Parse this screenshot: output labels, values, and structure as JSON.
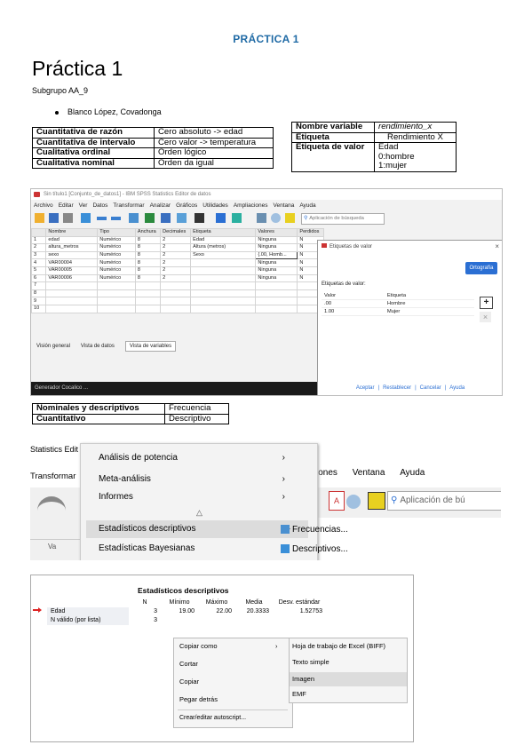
{
  "header": "PRÁCTICA 1",
  "title": "Práctica 1",
  "subtitle": "Subgrupo AA_9",
  "members": [
    "Blanco López, Covadonga"
  ],
  "var_types_table": [
    [
      "Cuantitativa de razón",
      "Cero absoluto -> edad"
    ],
    [
      "Cuantitativa de intervalo",
      "Cero valor -> temperatura"
    ],
    [
      "Cualitativa ordinal",
      "Orden lógico"
    ],
    [
      "Cualitativa nominal",
      "Orden da igual"
    ]
  ],
  "var_props_table": {
    "nombre_label": "Nombre variable",
    "nombre_value": "rendimiento_x",
    "etiqueta_label": "Etiqueta",
    "etiqueta_value": "Rendimiento X",
    "valor_label": "Etiqueta de valor",
    "valor_lines": [
      "Edad",
      "0:hombre",
      "1:mujer"
    ]
  },
  "spss": {
    "window_title": "Sin título1 [Conjunto_de_datos1] - IBM SPSS Statistics Editor de datos",
    "menu": [
      "Archivo",
      "Editar",
      "Ver",
      "Datos",
      "Transformar",
      "Analizar",
      "Gráficos",
      "Utilidades",
      "Ampliaciones",
      "Ventana",
      "Ayuda"
    ],
    "search_placeholder": "Aplicación de búsqueda",
    "columns": [
      "",
      "Nombre",
      "Tipo",
      "Anchura",
      "Decimales",
      "Etiqueta",
      "Valores",
      "Perdidos",
      "Columnas",
      "Alineación",
      "Medida",
      "Rol"
    ],
    "rows": [
      [
        "1",
        "edad",
        "Numérico",
        "8",
        "2",
        "Edad",
        "Ninguna",
        "N"
      ],
      [
        "2",
        "altura_metros",
        "Numérico",
        "8",
        "2",
        "Altura (metros)",
        "Ninguna",
        "N"
      ],
      [
        "3",
        "sexo",
        "Numérico",
        "8",
        "2",
        "Sexo",
        "{.00, Homb...",
        "N"
      ],
      [
        "4",
        "VAR00004",
        "Numérico",
        "8",
        "2",
        "",
        "Ninguna",
        "N"
      ],
      [
        "5",
        "VAR00005",
        "Numérico",
        "8",
        "2",
        "",
        "Ninguna",
        "N"
      ],
      [
        "6",
        "VAR00006",
        "Numérico",
        "8",
        "2",
        "",
        "Ninguna",
        "N"
      ],
      [
        "7",
        "",
        "",
        "",
        "",
        "",
        "",
        ""
      ],
      [
        "8",
        "",
        "",
        "",
        "",
        "",
        "",
        ""
      ],
      [
        "9",
        "",
        "",
        "",
        "",
        "",
        "",
        ""
      ],
      [
        "10",
        "",
        "",
        "",
        "",
        "",
        "",
        ""
      ]
    ],
    "tabs": [
      "Visión general",
      "Vista de datos",
      "Vista de variables"
    ],
    "status": "Generador Cocalico ...",
    "dialog": {
      "title": "Etiquetas de valor",
      "ortografia": "Ortografía",
      "section": "Etiquetas de valor:",
      "col_valor": "Valor",
      "col_etiqueta": "Etiqueta",
      "items": [
        [
          ".00",
          "Hombre"
        ],
        [
          "1.00",
          "Mujer"
        ]
      ],
      "buttons": [
        "Aceptar",
        "Restablecer",
        "Cancelar",
        "Ayuda"
      ]
    }
  },
  "table2": [
    [
      "Nominales y descriptivos",
      "Frecuencia"
    ],
    [
      "Cuantitativo",
      "Descriptivo"
    ]
  ],
  "menu_shot": {
    "top_left_1": "Statistics Edit",
    "top_left_2": "Transformar",
    "top_right": [
      "iones",
      "Ventana",
      "Ayuda"
    ],
    "search_placeholder": "Aplicación de bú",
    "items": [
      "Análisis de potencia",
      "Meta-análisis",
      "Informes",
      "Estadísticos descriptivos",
      "Estadísticas Bayesianas"
    ],
    "sub_items": [
      "Frecuencias...",
      "Descriptivos..."
    ],
    "left_col": "Va"
  },
  "desc_stats": {
    "title": "Estadísticos descriptivos",
    "headers": [
      "",
      "N",
      "Mínimo",
      "Máximo",
      "Media",
      "Desv. estándar"
    ],
    "row1": [
      "Edad",
      "3",
      "19.00",
      "22.00",
      "20.3333",
      "1.52753"
    ],
    "row2": [
      "N válido (por lista)",
      "3"
    ],
    "context_menu": [
      "Copiar como",
      "Cortar",
      "Copiar",
      "Pegar detrás",
      "Crear/editar autoscript..."
    ],
    "submenu": [
      "Hoja de trabajo de Excel (BIFF)",
      "Texto simple",
      "Imagen",
      "EMF"
    ]
  }
}
